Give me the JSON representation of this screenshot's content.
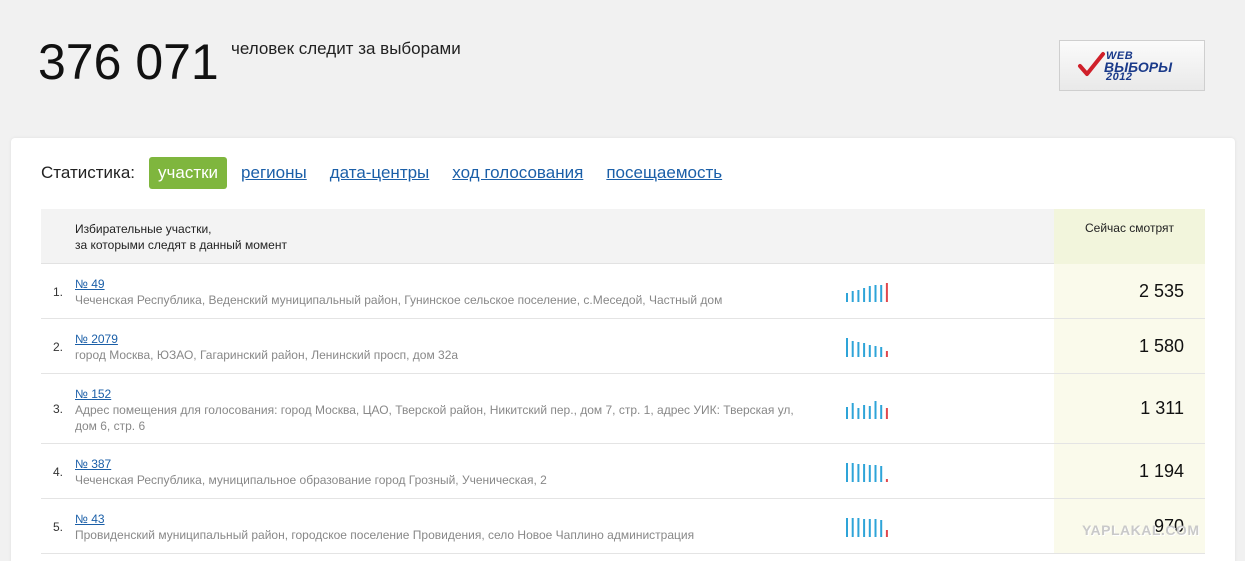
{
  "header": {
    "counter": "376 071",
    "counter_label": "человек следит за выборами"
  },
  "logo": {
    "line1": "WEB",
    "line2": "ВЫБОРЫ",
    "line3": "2012"
  },
  "stats": {
    "label": "Статистика:",
    "tabs": [
      {
        "label": "участки",
        "active": true
      },
      {
        "label": "регионы",
        "active": false
      },
      {
        "label": "дата-центры",
        "active": false
      },
      {
        "label": "ход голосования",
        "active": false
      },
      {
        "label": "посещаемость",
        "active": false
      }
    ]
  },
  "table": {
    "header_left_line1": "Избирательные участки,",
    "header_left_line2": "за которыми следят в данный момент",
    "header_right": "Сейчас смотрят",
    "rows": [
      {
        "index": "1.",
        "station": "№ 49",
        "address": "Чеченская Республика, Веденский муниципальный район, Гунинское сельское поселение, с.Меседой, Частный дом",
        "watching": "2 535",
        "trend": [
          0.45,
          0.55,
          0.6,
          0.7,
          0.8,
          0.85,
          0.85,
          0.95
        ]
      },
      {
        "index": "2.",
        "station": "№ 2079",
        "address": "город Москва, ЮЗАО, Гагаринский район, Ленинский просп, дом 32а",
        "watching": "1 580",
        "trend": [
          0.95,
          0.8,
          0.75,
          0.7,
          0.6,
          0.55,
          0.5,
          0.3
        ]
      },
      {
        "index": "3.",
        "station": "№ 152",
        "address": "Адрес помещения для голосования: город Москва, ЦАО, Тверской район, Никитский пер., дом 7, стр. 1, адрес УИК: Тверская ул, дом 6, стр. 6",
        "watching": "1 311",
        "trend": [
          0.6,
          0.8,
          0.55,
          0.7,
          0.65,
          0.9,
          0.7,
          0.55
        ]
      },
      {
        "index": "4.",
        "station": "№ 387",
        "address": "Чеченская Республика, муниципальное образование город Грозный, Ученическая, 2",
        "watching": "1 194",
        "trend": [
          0.95,
          0.95,
          0.9,
          0.9,
          0.85,
          0.85,
          0.8,
          0.15
        ]
      },
      {
        "index": "5.",
        "station": "№ 43",
        "address": "Провиденский муниципальный район, городское поселение Провидения, село Новое Чаплино администрация",
        "watching": "970",
        "trend": [
          0.95,
          0.95,
          0.95,
          0.9,
          0.9,
          0.9,
          0.85,
          0.35
        ]
      }
    ]
  },
  "watermark": "YAPLAKAL.COM",
  "colors": {
    "accent_green": "#7fb63e",
    "link_blue": "#1b5fa8",
    "spark_blue": "#2ea4d8",
    "spark_red": "#e0474c"
  }
}
